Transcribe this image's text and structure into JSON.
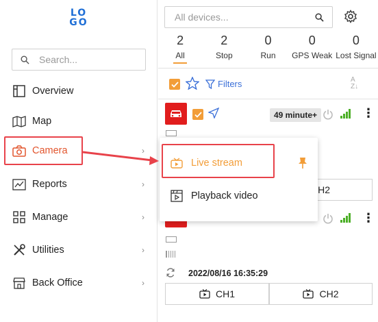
{
  "sidebar": {
    "logo_text": "LOGO",
    "search_placeholder": "Search...",
    "items": [
      {
        "label": "Overview",
        "icon": "layout-icon"
      },
      {
        "label": "Map",
        "icon": "map-icon"
      },
      {
        "label": "Camera",
        "icon": "camera-icon",
        "active": true
      },
      {
        "label": "Reports",
        "icon": "chart-icon"
      },
      {
        "label": "Manage",
        "icon": "grid-icon"
      },
      {
        "label": "Utilities",
        "icon": "tools-icon"
      },
      {
        "label": "Back Office",
        "icon": "store-icon"
      }
    ]
  },
  "devices_panel": {
    "search_placeholder": "All devices...",
    "stats": [
      {
        "count": "2",
        "label": "All",
        "selected": true
      },
      {
        "count": "2",
        "label": "Stop"
      },
      {
        "count": "0",
        "label": "Run"
      },
      {
        "count": "0",
        "label": "GPS Weak"
      },
      {
        "count": "0",
        "label": "Lost Signal"
      }
    ],
    "filters_label": "Filters",
    "device1": {
      "time_badge": "49 minute+",
      "ch2_label": "CH2"
    },
    "device2": {
      "timestamp": "2022/08/16 16:35:29",
      "ch1_label": "CH1",
      "ch2_label": "CH2"
    }
  },
  "popup_menu": {
    "items": [
      {
        "label": "Live stream",
        "icon": "live-stream-icon",
        "pinned": true
      },
      {
        "label": "Playback video",
        "icon": "playback-icon"
      }
    ]
  },
  "colors": {
    "accent_orange": "#f29d38",
    "active_text": "#e2552d",
    "highlight_red": "#e8424a",
    "car_red": "#e11d1d",
    "link_blue": "#3a6fd8",
    "signal_green": "#4caf27"
  }
}
